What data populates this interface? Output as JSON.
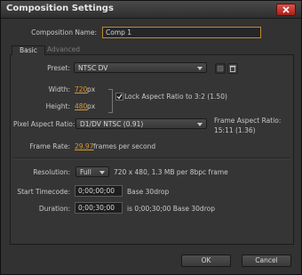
{
  "window": {
    "title": "Composition Settings"
  },
  "composition_name": {
    "label": "Composition Name:",
    "value": "Comp 1"
  },
  "tabs": [
    {
      "label": "Basic"
    },
    {
      "label": "Advanced"
    }
  ],
  "preset": {
    "label": "Preset:",
    "value": "NTSC DV"
  },
  "width": {
    "label": "Width:",
    "value": "720",
    "unit": "px"
  },
  "height": {
    "label": "Height:",
    "value": "480",
    "unit": "px"
  },
  "lock_aspect": {
    "label": "Lock Aspect Ratio to 3:2 (1.50)",
    "checked": true
  },
  "pixel_aspect": {
    "label": "Pixel Aspect Ratio:",
    "value": "D1/DV NTSC (0.91)"
  },
  "frame_aspect": {
    "label": "Frame Aspect Ratio:",
    "value": "15:11 (1.36)"
  },
  "frame_rate": {
    "label": "Frame Rate:",
    "value": "29.97",
    "unit": "frames per second"
  },
  "resolution": {
    "label": "Resolution:",
    "value": "Full",
    "info": "720 x 480, 1.3 MB per 8bpc frame"
  },
  "start_timecode": {
    "label": "Start Timecode:",
    "value": "0;00;00;00",
    "base": "Base 30drop"
  },
  "duration": {
    "label": "Duration:",
    "value": "0;00;30;00",
    "info": "is 0;00;30;00  Base 30drop"
  },
  "buttons": {
    "ok": "OK",
    "cancel": "Cancel"
  },
  "colors": {
    "accent": "#d69a35",
    "close": "#c0392b"
  }
}
